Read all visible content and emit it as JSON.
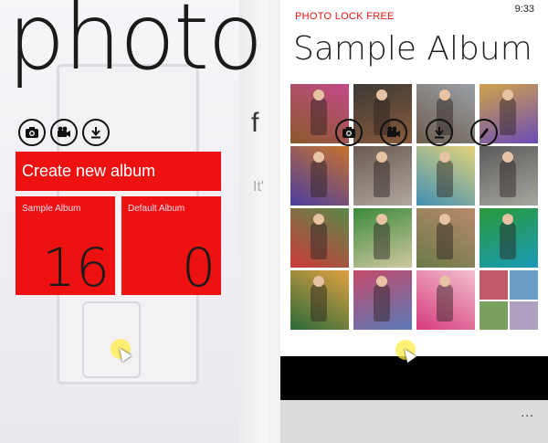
{
  "left_page": {
    "title": "photo",
    "peek_title": "f",
    "peek_sub": "It'",
    "toolbar": [
      {
        "icon": "camera-icon"
      },
      {
        "icon": "video-camera-icon"
      },
      {
        "icon": "download-icon"
      }
    ],
    "create_tile_label": "Create new album",
    "albums": [
      {
        "label": "Sample Album",
        "count": "16"
      },
      {
        "label": "Default Album",
        "count": "0"
      }
    ],
    "tile_color": "#ee1111"
  },
  "right_page": {
    "app_name": "PHOTO LOCK FREE",
    "clock": "9:33",
    "album_title": "Sample Album",
    "app_bar_icons": [
      "camera-icon",
      "video-camera-icon",
      "download-icon",
      "edit-icon"
    ],
    "more_label": "...",
    "thumbnails": [
      {
        "colors": [
          "#8a5a2a",
          "#c44a8a"
        ]
      },
      {
        "colors": [
          "#3b3a35",
          "#8b5a3c"
        ]
      },
      {
        "colors": [
          "#6d5d4e",
          "#9aa0a6"
        ]
      },
      {
        "colors": [
          "#d1a34a",
          "#6a4bb8"
        ]
      },
      {
        "colors": [
          "#4a3da0",
          "#c8732e"
        ]
      },
      {
        "colors": [
          "#6a5a50",
          "#b0a8a0"
        ]
      },
      {
        "colors": [
          "#3e8fb5",
          "#e5d37a"
        ]
      },
      {
        "colors": [
          "#5a5a5a",
          "#a8a8a0"
        ]
      },
      {
        "colors": [
          "#cc3a3a",
          "#5a8a4a"
        ]
      },
      {
        "colors": [
          "#3a8a3a",
          "#d0c8a0"
        ]
      },
      {
        "colors": [
          "#6a7a4a",
          "#b88a6a"
        ]
      },
      {
        "colors": [
          "#2a9a3a",
          "#1a9ab8"
        ]
      },
      {
        "colors": [
          "#2a6a3a",
          "#e0a040"
        ]
      },
      {
        "colors": [
          "#c44a6a",
          "#5a7ab8"
        ]
      },
      {
        "colors": [
          "#d63a7a",
          "#f2c0d0"
        ]
      },
      {
        "mosaic": [
          "#c05a6a",
          "#6aa0c8",
          "#7aa060",
          "#b0a0c0"
        ]
      }
    ]
  }
}
